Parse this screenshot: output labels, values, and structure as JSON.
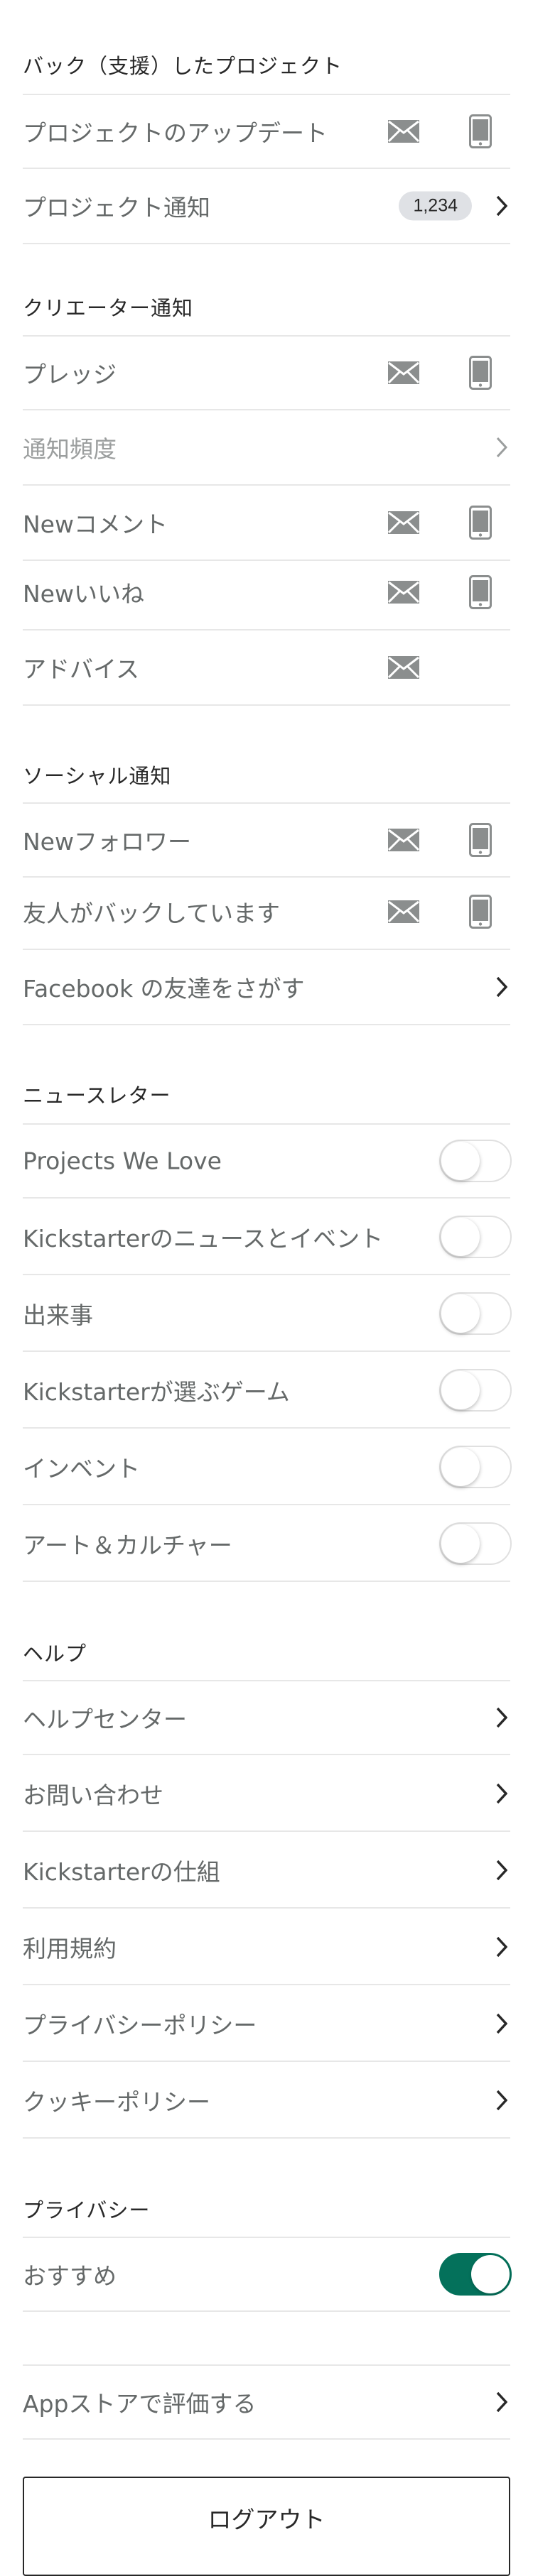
{
  "sections": {
    "backed": {
      "title": "バック（支援）したプロジェクト",
      "rows": [
        "プロジェクトのアップデート",
        "プロジェクト通知"
      ],
      "badge": "1,234"
    },
    "creator": {
      "title": "クリエーター通知",
      "rows": [
        "プレッジ",
        "通知頻度",
        "Newコメント",
        "Newいいね",
        "アドバイス"
      ]
    },
    "social": {
      "title": "ソーシャル通知",
      "rows": [
        "Newフォロワー",
        "友人がバックしています",
        "Facebook の友達をさがす"
      ]
    },
    "newsletter": {
      "title": "ニュースレター",
      "rows": [
        "Projects We Love",
        "Kickstarterのニュースとイベント",
        "出来事",
        "Kickstarterが選ぶゲーム",
        "インベント",
        "アート＆カルチャー"
      ],
      "toggles_on": [
        false,
        false,
        false,
        false,
        false,
        false
      ]
    },
    "help": {
      "title": "ヘルプ",
      "rows": [
        "ヘルプセンター",
        "お問い合わせ",
        "Kickstarterの仕組",
        "利用規約",
        "プライバシーポリシー",
        "クッキーポリシー"
      ]
    },
    "privacy": {
      "title": "プライバシー",
      "rows": [
        "おすすめ"
      ],
      "toggle_on": true
    },
    "appstore": {
      "label": "Appストアで評価する"
    }
  },
  "logout_label": "ログアウト",
  "colors": {
    "accent": "#04715b",
    "text": "#656969",
    "heading": "#282828"
  },
  "icons": [
    "mail-icon",
    "phone-icon",
    "chevron-right-icon"
  ]
}
